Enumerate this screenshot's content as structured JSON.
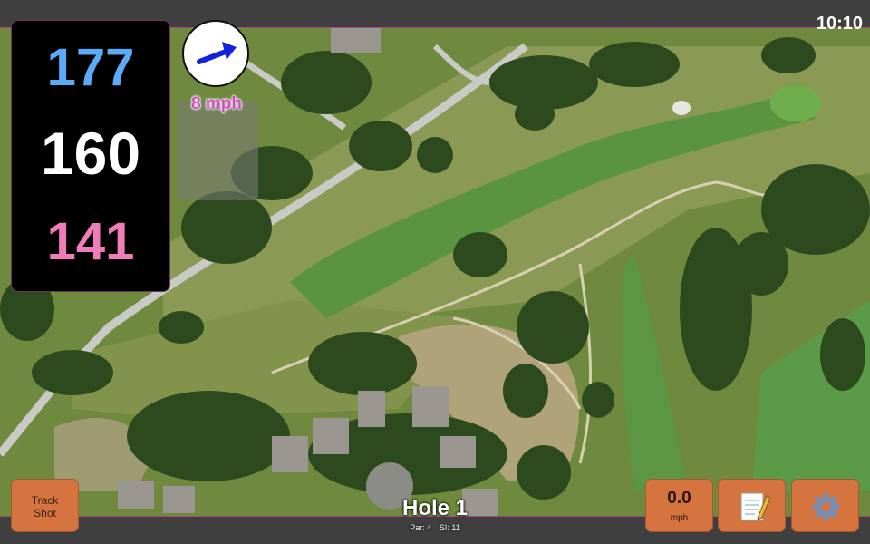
{
  "clock": "10:10",
  "yardages": {
    "back": "177",
    "middle": "160",
    "front": "141"
  },
  "wind": {
    "speed": "8 mph",
    "direction_icon": "wind-arrow-icon"
  },
  "buttons": {
    "track_shot": {
      "line1": "Track",
      "line2": "Shot"
    },
    "speed": {
      "value": "0.0",
      "unit": "mph"
    },
    "notes_icon": "notepad-icon",
    "settings_icon": "gear-icon"
  },
  "hole": {
    "title": "Hole 1",
    "par": "Par: 4",
    "si": "SI: 11"
  },
  "colors": {
    "back": "#5aaaf5",
    "middle": "#ffffff",
    "front": "#f07cb8",
    "button": "#d6743f",
    "wind": "#d04fc0"
  }
}
